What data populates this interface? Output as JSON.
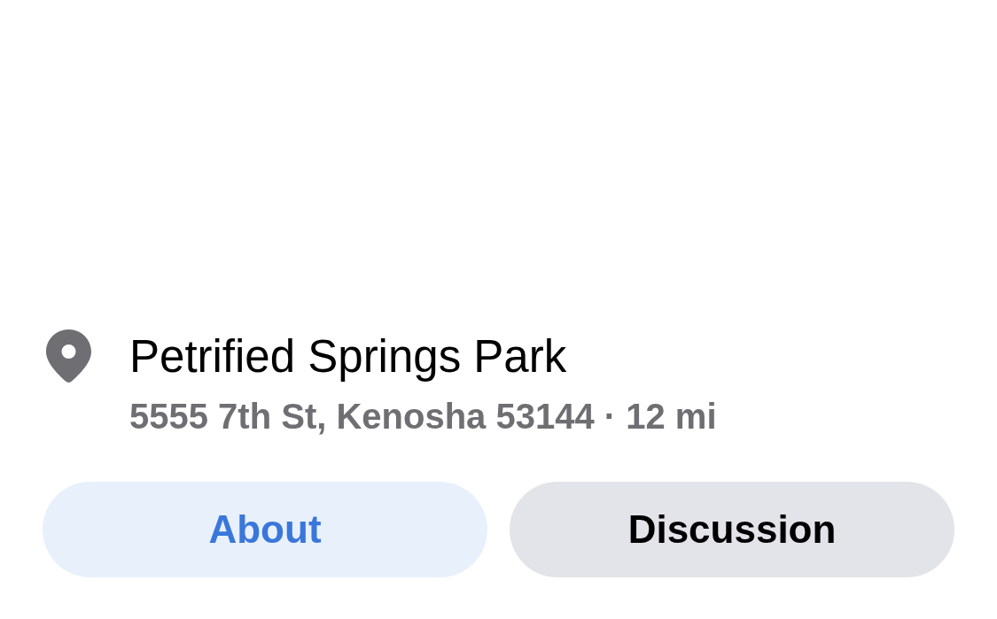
{
  "place": {
    "name": "Petrified Springs Park",
    "address": "5555 7th St, Kenosha 53144 · 12 mi"
  },
  "tabs": [
    {
      "label": "About",
      "selected": true
    },
    {
      "label": "Discussion",
      "selected": false
    }
  ]
}
